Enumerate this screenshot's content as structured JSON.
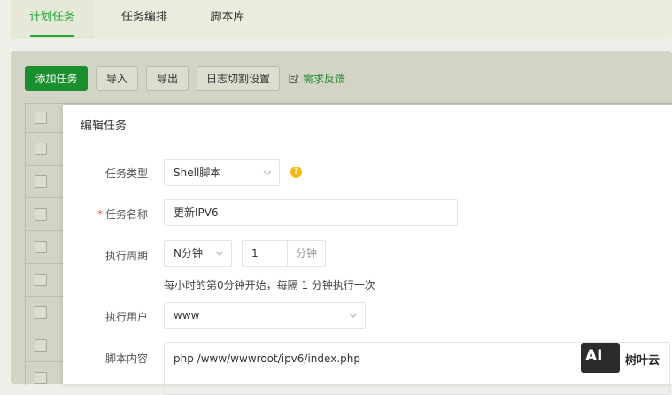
{
  "tabs": [
    {
      "label": "计划任务",
      "active": true
    },
    {
      "label": "任务编排",
      "active": false
    },
    {
      "label": "脚本库",
      "active": false
    }
  ],
  "toolbar": {
    "add_label": "添加任务",
    "import_label": "导入",
    "export_label": "导出",
    "log_label": "日志切割设置",
    "feedback_label": "需求反馈"
  },
  "modal": {
    "title": "编辑任务",
    "task_type": {
      "label": "任务类型",
      "value": "Shell脚本"
    },
    "task_name": {
      "label": "任务名称",
      "value": "更新IPV6",
      "required_mark": "*"
    },
    "period": {
      "label": "执行周期",
      "mode": "N分钟",
      "minutes": "1",
      "unit": "分钟",
      "hint": "每小时的第0分钟开始，每隔 1 分钟执行一次"
    },
    "user": {
      "label": "执行用户",
      "value": "www"
    },
    "script": {
      "label": "脚本内容",
      "value": "php /www/wwwroot/ipv6/index.php"
    }
  },
  "watermark": {
    "logo": "AI",
    "text": "树叶云"
  },
  "colors": {
    "accent": "#20a53a",
    "primary_button": "#1a8f2e",
    "help_icon": "#f5b80e",
    "required": "#e33333"
  }
}
